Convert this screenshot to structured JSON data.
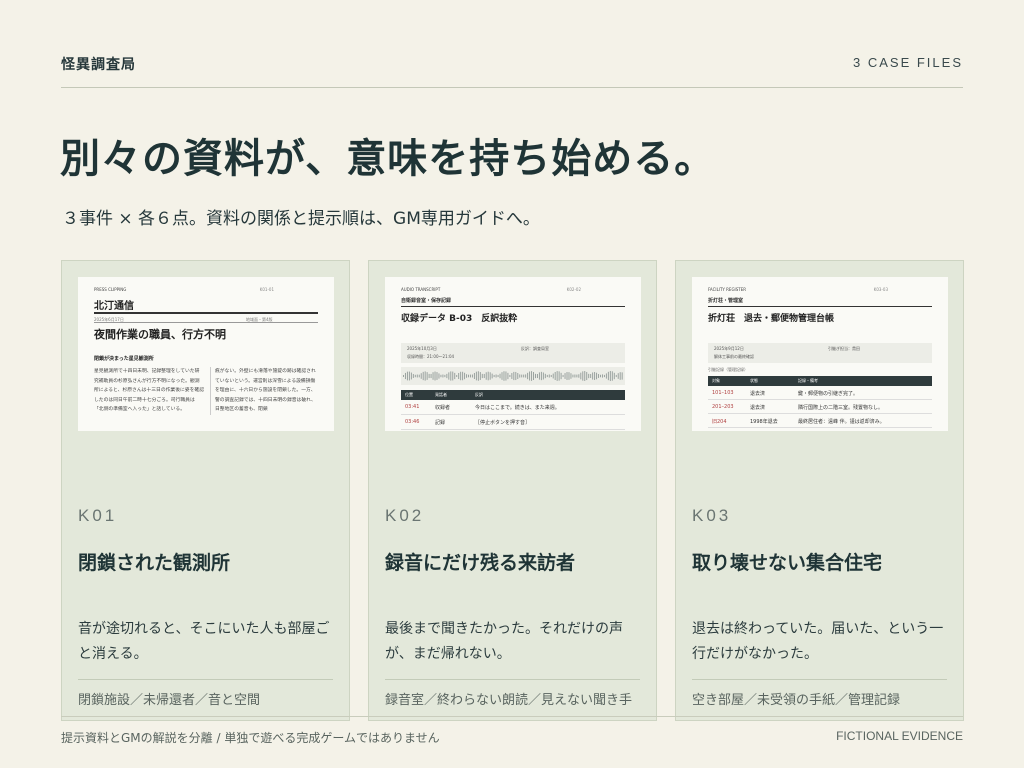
{
  "header": {
    "org": "怪異調査局",
    "count_label": "3 CASE FILES"
  },
  "title": "別々の資料が、意味を持ち始める。",
  "subtitle": "３事件 × 各６点。資料の関係と提示順は、GM専用ガイドへ。",
  "cards": [
    {
      "code": "K01",
      "title": "閉鎖された観測所",
      "desc": "音が途切れると、そこにいた人も部屋ごと消える。",
      "tags": "閉鎖施設／未帰還者／音と空間",
      "doc": {
        "tag": "PRESS CLIPPING",
        "tag_right": "K01-01",
        "paper": "北汀通信",
        "date": "2025年6月17日",
        "date_right": "地域面・第4版",
        "headline": "夜間作業の職員、行方不明",
        "subhead": "閉鎖が決まった星见観測所",
        "col_a": "星見観測所で十四日未明、記録整理をしていた研究補助員の杉原弘さんが行方不明になった。観測所によると、杉原さんは十三日の作業後に姿を確認したのは同日午前二時十七分ごろ。司行職員は「北側の準備室へ入った」と話している。",
        "col_b": "痕がない。外壁にも滑落や施錠の跡は確認されていないという。運営則は深雪による設備損傷を理由に、十六日から施設を閉鎖した。一方、警の調査記録では、十四日未明の録音は破れ、日整地区の蓄音も、閉鎖"
      }
    },
    {
      "code": "K02",
      "title": "録音にだけ残る来訪者",
      "desc": "最後まで聞きたかった。それだけの声が、まだ帰れない。",
      "tags": "録音室／終わらない朗読／見えない聞き手",
      "doc": {
        "tag": "AUDIO TRANSCRIPT",
        "tag_right": "K02-02",
        "label": "自衛録音室・保存記録",
        "title": "収録データ B-03　反訳抜粋",
        "meta_a": "2025年10月3日",
        "meta_b": "反訳：調査局室",
        "meta_c": "収録時間：21:00〜21:04",
        "th": [
          "位置",
          "発話者",
          "反訳"
        ],
        "rows": [
          [
            "03:41",
            "収録者",
            "今日はここまで。続きは、また来週。"
          ],
          [
            "03:46",
            "記録",
            "［停止ボタンを押す音］"
          ]
        ]
      }
    },
    {
      "code": "K03",
      "title": "取り壊せない集合住宅",
      "desc": "退去は終わっていた。届いた、という一行だけがなかった。",
      "tags": "空き部屋／未受領の手紙／管理記録",
      "doc": {
        "tag": "FACILITY REGISTER",
        "tag_right": "K03-03",
        "label": "折灯荘・管理室",
        "title": "折灯荘　退去・郵便物管理台帳",
        "meta_a": "2025年9月12日",
        "meta_b": "引継ぎ担当：貴田",
        "meta_c": "解体工事前の最終確認",
        "caption": "引継記録（管理記録）",
        "th": [
          "対象",
          "状態",
          "記録・備考"
        ],
        "rows": [
          [
            "101–103",
            "退去済",
            "鍵・郵便物の引継ぎ完了。"
          ],
          [
            "201–203",
            "退去済",
            "隣行国際上の二階三室。残置物なし。"
          ],
          [
            "旧204",
            "1998年退去",
            "最終居住者：遠峰 伴。謹は返却済み。"
          ]
        ]
      }
    }
  ],
  "footer": {
    "left": "提示資料とGMの解説を分離 / 単独で遊べる完成ゲームではありません",
    "right": "FICTIONAL EVIDENCE"
  }
}
